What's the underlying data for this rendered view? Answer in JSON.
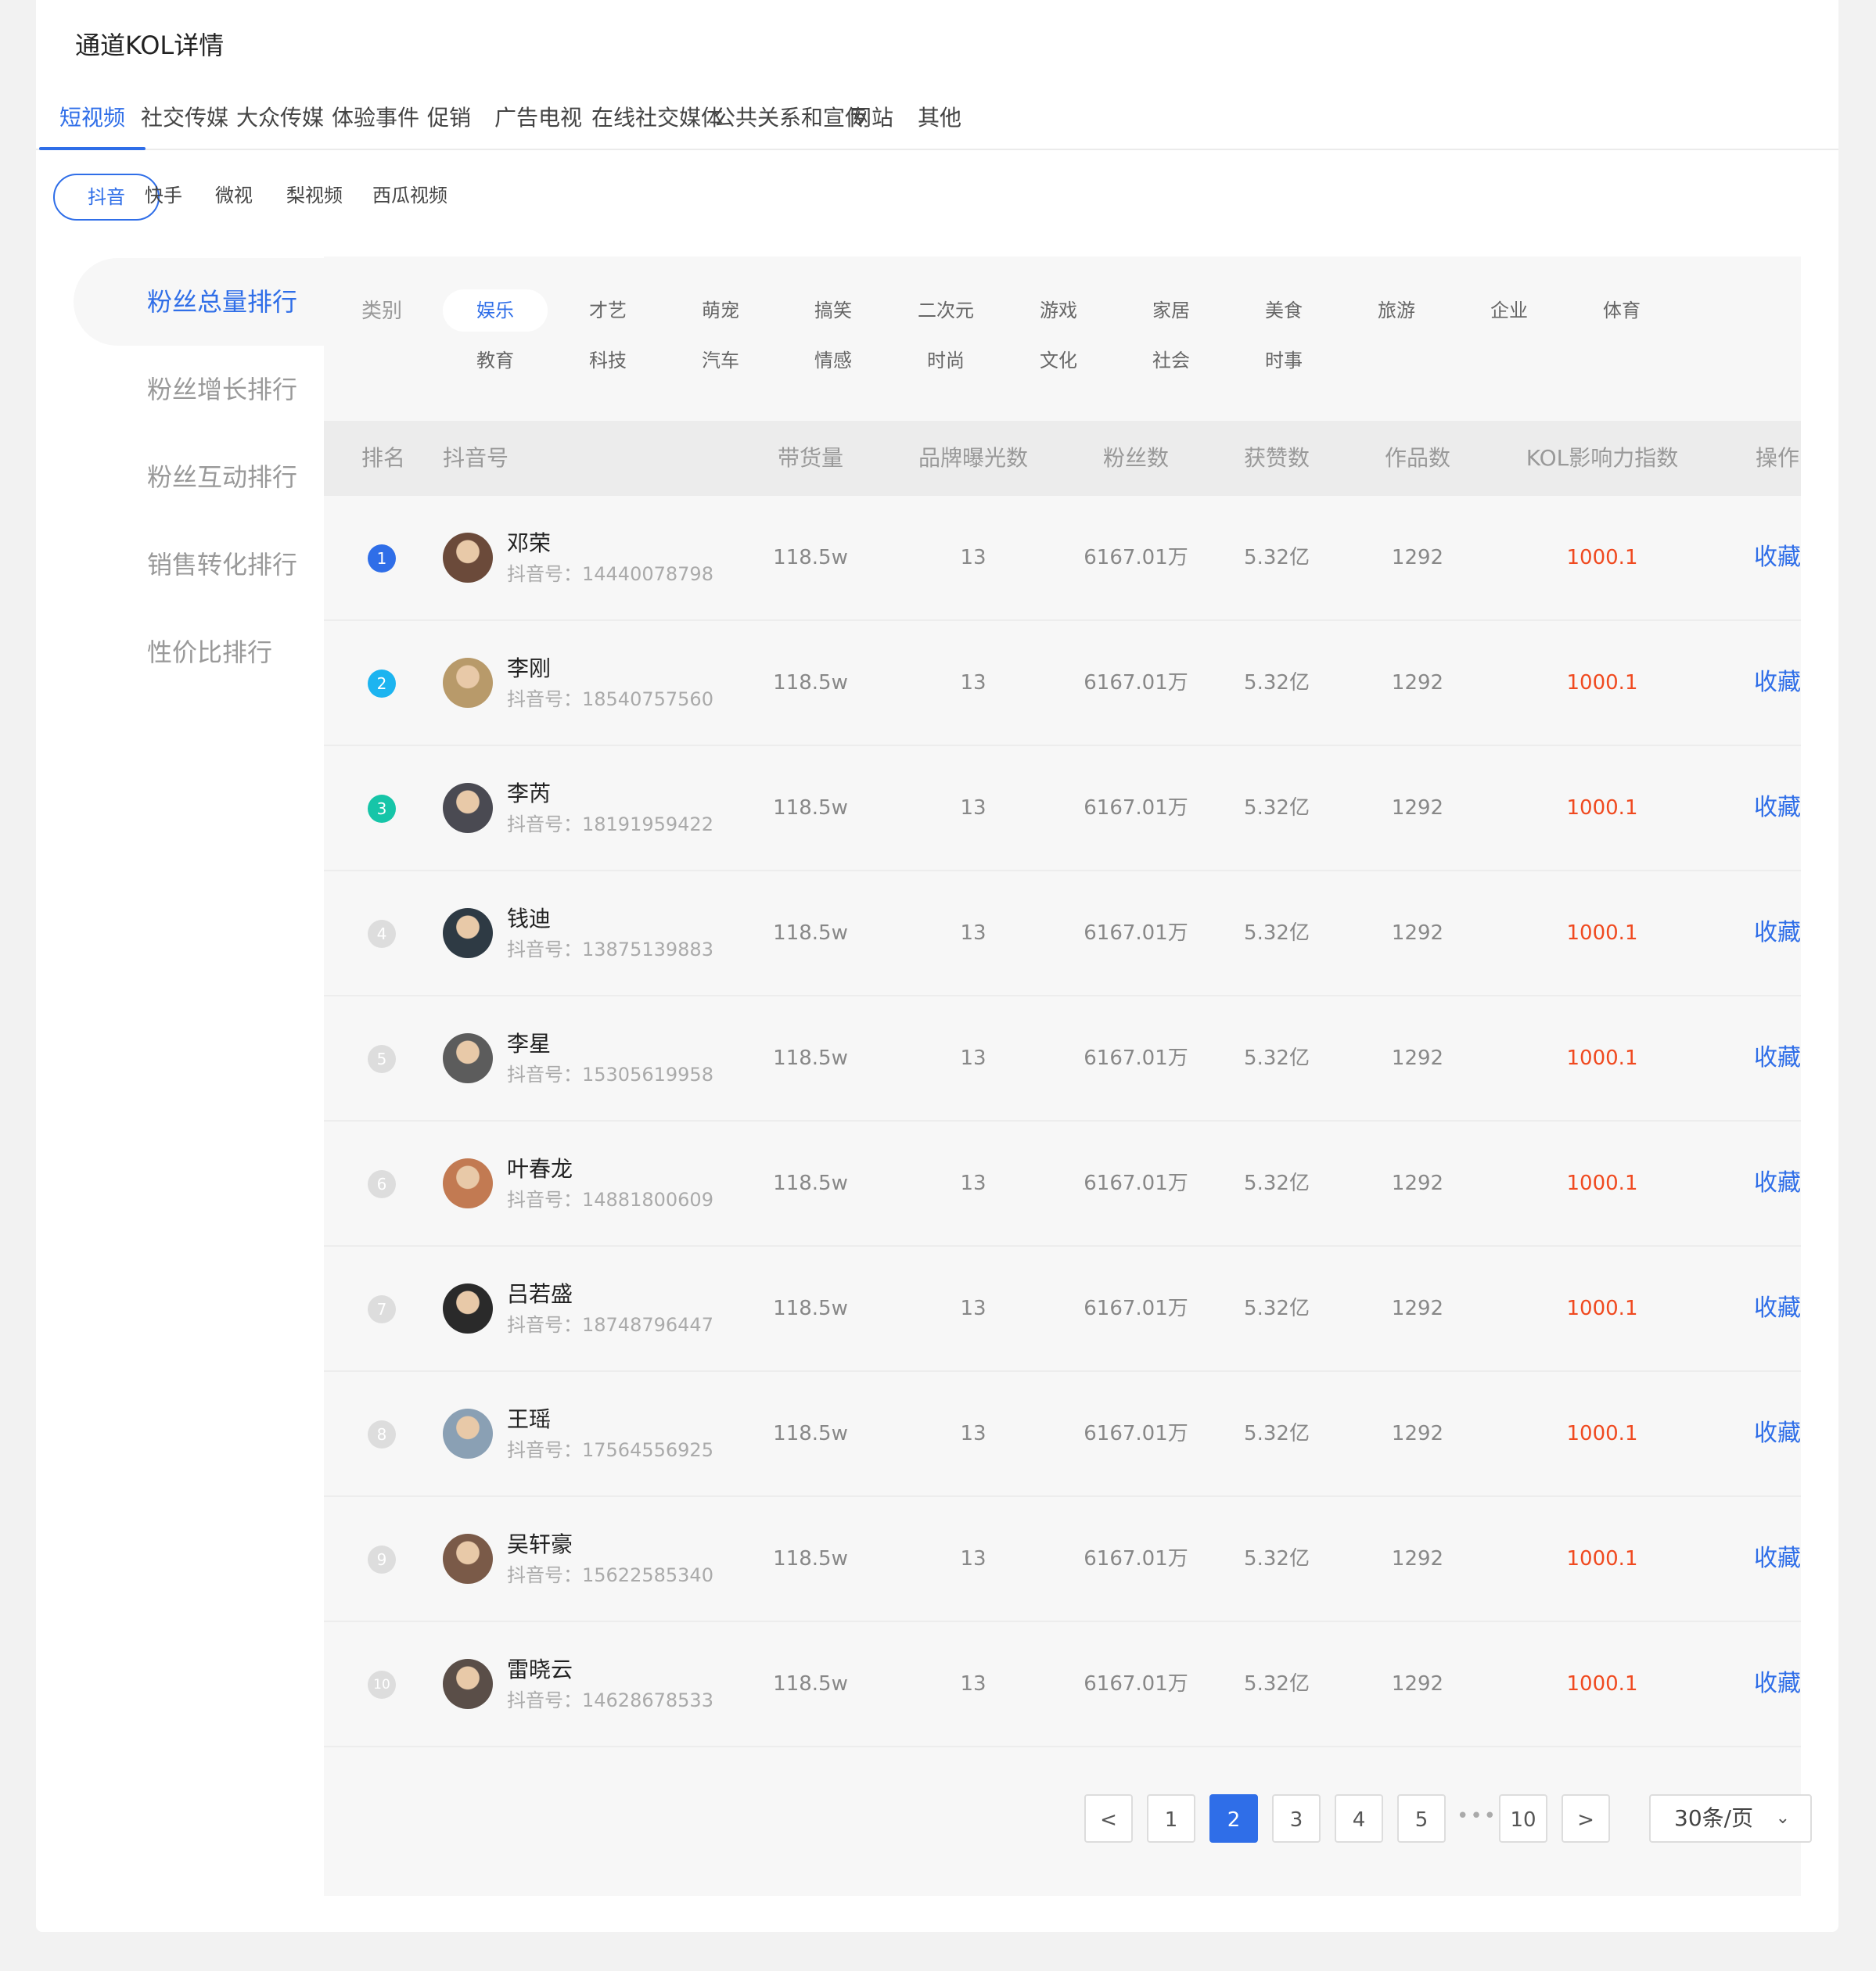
{
  "page": {
    "title": "通道KOL详情"
  },
  "main_tabs": [
    "短视频",
    "社交传媒",
    "大众传媒",
    "体验事件",
    "促销",
    "广告电视",
    "在线社交媒体",
    "公共关系和宣传",
    "网站",
    "其他"
  ],
  "main_tabs_active": "短视频",
  "platforms": [
    "抖音",
    "快手",
    "微视",
    "梨视频",
    "西瓜视频"
  ],
  "platform_active": "抖音",
  "sidebar": [
    "粉丝总量排行",
    "粉丝增长排行",
    "粉丝互动排行",
    "销售转化排行",
    "性价比排行"
  ],
  "sidebar_active": "粉丝总量排行",
  "category": {
    "label": "类别",
    "row1": [
      "娱乐",
      "才艺",
      "萌宠",
      "搞笑",
      "二次元",
      "游戏",
      "家居",
      "美食",
      "旅游",
      "企业",
      "体育"
    ],
    "row2": [
      "教育",
      "科技",
      "汽车",
      "情感",
      "时尚",
      "文化",
      "社会",
      "时事"
    ],
    "active": "娱乐"
  },
  "table": {
    "headers": [
      "排名",
      "抖音号",
      "带货量",
      "品牌曝光数",
      "粉丝数",
      "获赞数",
      "作品数",
      "KOL影响力指数",
      "操作"
    ],
    "rows": [
      {
        "rank": "1",
        "name": "邓荣",
        "handle": "抖音号：14440078798",
        "sales": "118.5w",
        "exposure": "13",
        "fans": "6167.01万",
        "likes": "5.32亿",
        "works": "1292",
        "kol": "1000.1",
        "action": "收藏"
      },
      {
        "rank": "2",
        "name": "李刚",
        "handle": "抖音号：18540757560",
        "sales": "118.5w",
        "exposure": "13",
        "fans": "6167.01万",
        "likes": "5.32亿",
        "works": "1292",
        "kol": "1000.1",
        "action": "收藏"
      },
      {
        "rank": "3",
        "name": "李芮",
        "handle": "抖音号：18191959422",
        "sales": "118.5w",
        "exposure": "13",
        "fans": "6167.01万",
        "likes": "5.32亿",
        "works": "1292",
        "kol": "1000.1",
        "action": "收藏"
      },
      {
        "rank": "4",
        "name": "钱迪",
        "handle": "抖音号：13875139883",
        "sales": "118.5w",
        "exposure": "13",
        "fans": "6167.01万",
        "likes": "5.32亿",
        "works": "1292",
        "kol": "1000.1",
        "action": "收藏"
      },
      {
        "rank": "5",
        "name": "李星",
        "handle": "抖音号：15305619958",
        "sales": "118.5w",
        "exposure": "13",
        "fans": "6167.01万",
        "likes": "5.32亿",
        "works": "1292",
        "kol": "1000.1",
        "action": "收藏"
      },
      {
        "rank": "6",
        "name": "叶春龙",
        "handle": "抖音号：14881800609",
        "sales": "118.5w",
        "exposure": "13",
        "fans": "6167.01万",
        "likes": "5.32亿",
        "works": "1292",
        "kol": "1000.1",
        "action": "收藏"
      },
      {
        "rank": "7",
        "name": "吕若盛",
        "handle": "抖音号：18748796447",
        "sales": "118.5w",
        "exposure": "13",
        "fans": "6167.01万",
        "likes": "5.32亿",
        "works": "1292",
        "kol": "1000.1",
        "action": "收藏"
      },
      {
        "rank": "8",
        "name": "王瑶",
        "handle": "抖音号：17564556925",
        "sales": "118.5w",
        "exposure": "13",
        "fans": "6167.01万",
        "likes": "5.32亿",
        "works": "1292",
        "kol": "1000.1",
        "action": "收藏"
      },
      {
        "rank": "9",
        "name": "吴轩豪",
        "handle": "抖音号：15622585340",
        "sales": "118.5w",
        "exposure": "13",
        "fans": "6167.01万",
        "likes": "5.32亿",
        "works": "1292",
        "kol": "1000.1",
        "action": "收藏"
      },
      {
        "rank": "10",
        "name": "雷晓云",
        "handle": "抖音号：14628678533",
        "sales": "118.5w",
        "exposure": "13",
        "fans": "6167.01万",
        "likes": "5.32亿",
        "works": "1292",
        "kol": "1000.1",
        "action": "收藏"
      }
    ]
  },
  "rank_colors": [
    "#2f6ee8",
    "#1cb4f0",
    "#16c5a8"
  ],
  "avatar_colors": [
    "#6b4a3a",
    "#b89a6a",
    "#4a4a52",
    "#2e3a44",
    "#5c5c5c",
    "#c27a52",
    "#2a2a2a",
    "#8aa0b4",
    "#7a5a48",
    "#5a4e48"
  ],
  "pagination": {
    "prev": "<",
    "pages": [
      "1",
      "2",
      "3",
      "4",
      "5"
    ],
    "ellipsis": "•••",
    "last": "10",
    "next": ">",
    "current": "2",
    "page_size": "30条/页",
    "page_size_chevron": "⌄"
  }
}
